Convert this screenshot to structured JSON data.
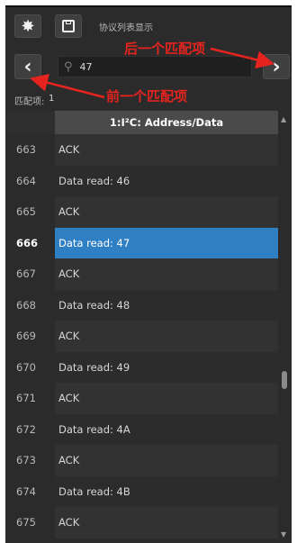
{
  "toolbar": {
    "gear_icon": "gear-icon",
    "save_icon": "save-icon",
    "title": "协议列表显示"
  },
  "search": {
    "prev_icon": "‹",
    "next_icon": "›",
    "value": "47",
    "icon": "search-icon"
  },
  "match": {
    "label": "匹配项:",
    "count": "1"
  },
  "annotations": {
    "next_match": "后一个匹配项",
    "prev_match": "前一个匹配项",
    "color": "#e5241f"
  },
  "table": {
    "column_header": "1:I²C: Address/Data",
    "rows": [
      {
        "num": "663",
        "text": "ACK"
      },
      {
        "num": "664",
        "text": "Data read: 46"
      },
      {
        "num": "665",
        "text": "ACK"
      },
      {
        "num": "666",
        "text": "Data read: 47",
        "selected": true
      },
      {
        "num": "667",
        "text": "ACK"
      },
      {
        "num": "668",
        "text": "Data read: 48"
      },
      {
        "num": "669",
        "text": "ACK"
      },
      {
        "num": "670",
        "text": "Data read: 49"
      },
      {
        "num": "671",
        "text": "ACK"
      },
      {
        "num": "672",
        "text": "Data read: 4A"
      },
      {
        "num": "673",
        "text": "ACK"
      },
      {
        "num": "674",
        "text": "Data read: 4B"
      },
      {
        "num": "675",
        "text": "ACK"
      }
    ],
    "selected_color": "#2f7fc4"
  }
}
